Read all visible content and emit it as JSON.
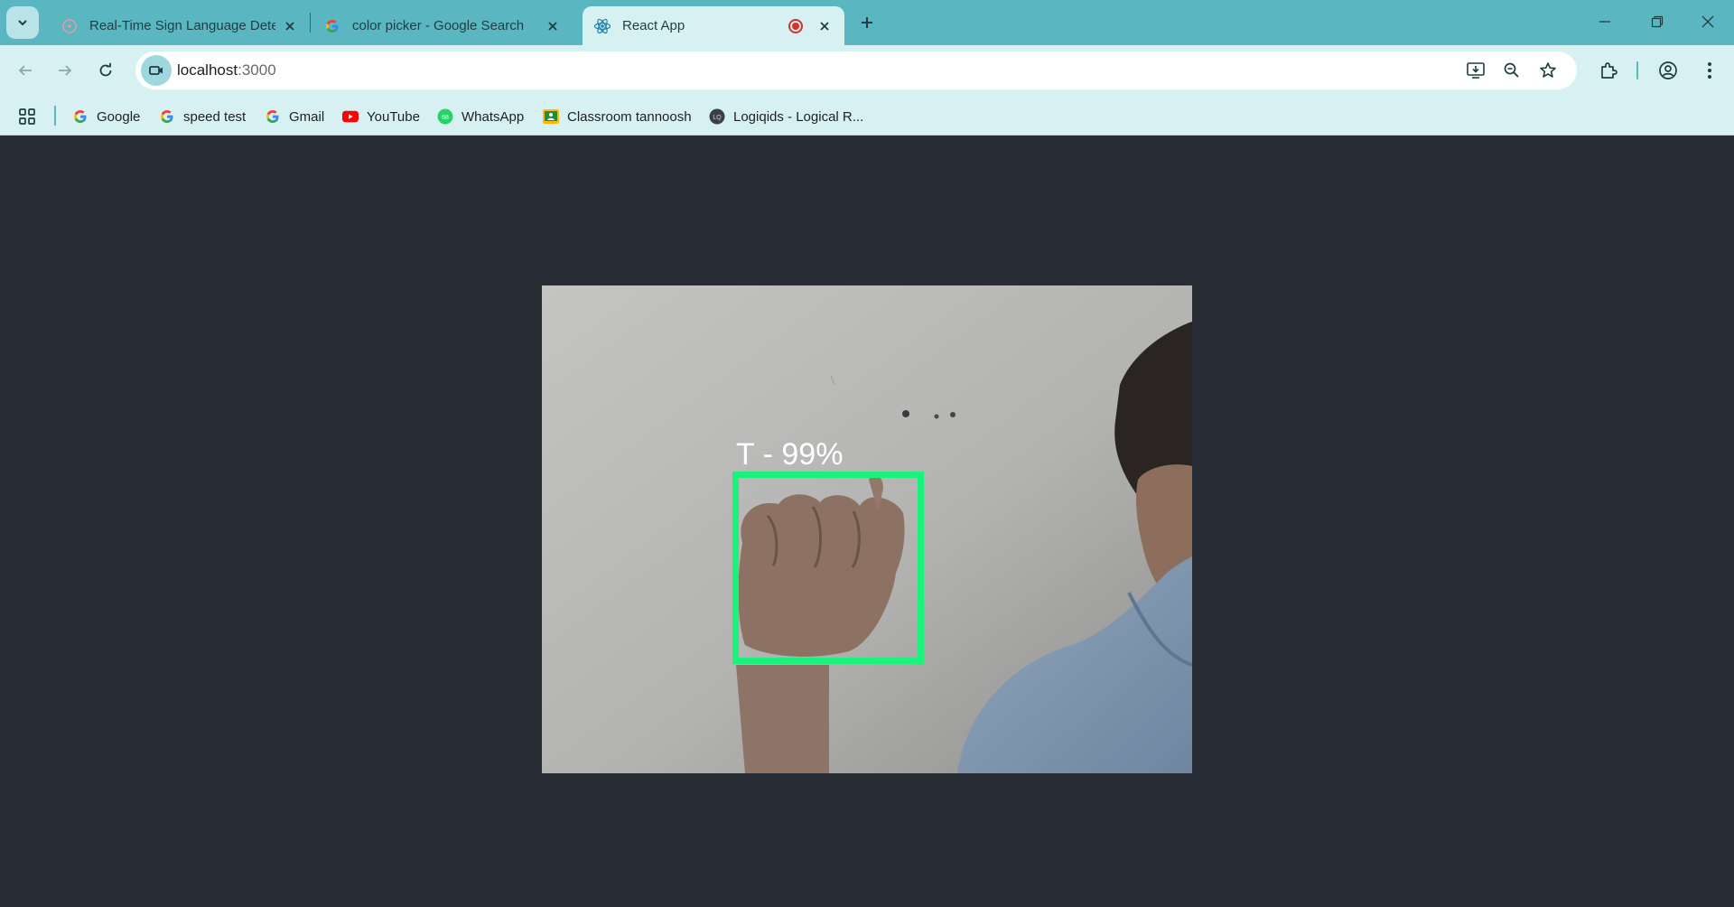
{
  "browser": {
    "tabs": [
      {
        "title": "Real-Time Sign Language Detec",
        "favicon": "react-faded-icon",
        "active": false
      },
      {
        "title": "color picker - Google Search",
        "favicon": "google-icon",
        "active": false
      },
      {
        "title": "React App",
        "favicon": "react-icon",
        "active": true,
        "recording": true
      }
    ],
    "address": {
      "host": "localhost",
      "port": ":3000"
    },
    "bookmarks": [
      {
        "label": "Google",
        "icon": "google-icon"
      },
      {
        "label": "speed test",
        "icon": "google-icon"
      },
      {
        "label": "Gmail",
        "icon": "google-icon"
      },
      {
        "label": "YouTube",
        "icon": "youtube-icon"
      },
      {
        "label": "WhatsApp",
        "icon": "whatsapp-icon"
      },
      {
        "label": "Classroom tannoosh",
        "icon": "classroom-icon"
      },
      {
        "label": "Logiqids - Logical R...",
        "icon": "logiqids-icon"
      }
    ]
  },
  "app": {
    "detection": {
      "label": "T - 99%",
      "box_color": "#19f27d"
    },
    "background": "#282c34"
  },
  "colors": {
    "tabstrip": "#5ab7c1",
    "toolbar": "#d7f1f3",
    "accent": "#19f27d"
  }
}
